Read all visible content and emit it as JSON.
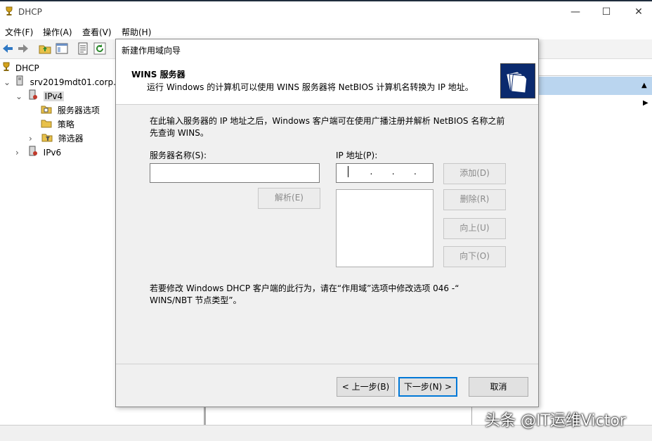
{
  "window": {
    "title": "DHCP",
    "minimize": "—",
    "maximize": "☐",
    "close": "✕"
  },
  "menu": {
    "items": [
      "文件(F)",
      "操作(A)",
      "查看(V)",
      "帮助(H)"
    ]
  },
  "tree": {
    "root": "DHCP",
    "server": "srv2019mdt01.corp.v",
    "ipv4": "IPv4",
    "server_options": "服务器选项",
    "policies": "策略",
    "filters": "筛选器",
    "ipv6": "IPv6"
  },
  "dialog": {
    "title": "新建作用域向导",
    "header_title": "WINS 服务器",
    "header_subtitle": "运行 Windows 的计算机可以使用 WINS 服务器将 NetBIOS 计算机名转换为 IP 地址。",
    "intro_line1": "在此输入服务器的 IP 地址之后，Windows 客户端可在使用广播注册并解析 NetBIOS 名称之前",
    "intro_line2": "先查询 WINS。",
    "server_name_label": "服务器名称(S):",
    "server_name_value": "",
    "ip_label": "IP 地址(P):",
    "ip_value": "   .   .   .",
    "resolve_button": "解析(E)",
    "add_button": "添加(D)",
    "delete_button": "删除(R)",
    "up_button": "向上(U)",
    "down_button": "向下(O)",
    "note_line1": "若要修改 Windows DHCP 客户端的此行为，请在“作用域”选项中修改选项 046 -“",
    "note_line2": "WINS/NBT 节点类型”。",
    "back_button": "< 上一步(B)",
    "next_button": "下一步(N) >",
    "cancel_button": "取消"
  },
  "watermark": "头条 @IT运维Victor",
  "colors": {
    "accent": "#0078d7",
    "actions_header": "#bad5ef",
    "header_image": "#0b2a6e"
  }
}
